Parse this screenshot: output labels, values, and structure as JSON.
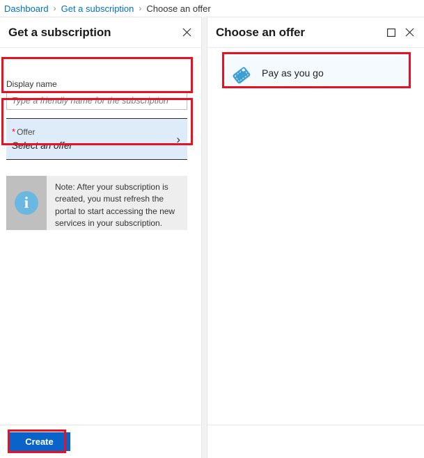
{
  "breadcrumb": {
    "items": [
      {
        "label": "Dashboard",
        "current": false
      },
      {
        "label": "Get a subscription",
        "current": false
      },
      {
        "label": "Choose an offer",
        "current": true
      }
    ],
    "separator": "›"
  },
  "left_blade": {
    "title": "Get a subscription",
    "close_label": "✕",
    "display_name": {
      "label": "Display name",
      "value": "",
      "placeholder": "Type a friendly name for the subscription"
    },
    "offer": {
      "required_marker": "*",
      "label": "Offer",
      "value": "Select an offer",
      "chevron": "›"
    },
    "note": {
      "icon": "info-icon",
      "text": "Note: After your subscription is created, you must refresh the portal to start accessing the new services in your subscription."
    },
    "footer": {
      "create_label": "Create"
    }
  },
  "right_blade": {
    "title": "Choose an offer",
    "maximize_label": "□",
    "close_label": "✕",
    "offers": [
      {
        "icon": "price-tag-icon",
        "name": "Pay as you go"
      }
    ]
  },
  "colors": {
    "accent_blue": "#0a63c9",
    "link_blue": "#0072c6",
    "highlight_red": "#e81123",
    "selected_row": "#deecf9",
    "info_icon": "#6ab7e0",
    "note_band": "#bfbfbf",
    "note_bg": "#eeeeee",
    "offer_card_bg": "#f4fafe"
  }
}
